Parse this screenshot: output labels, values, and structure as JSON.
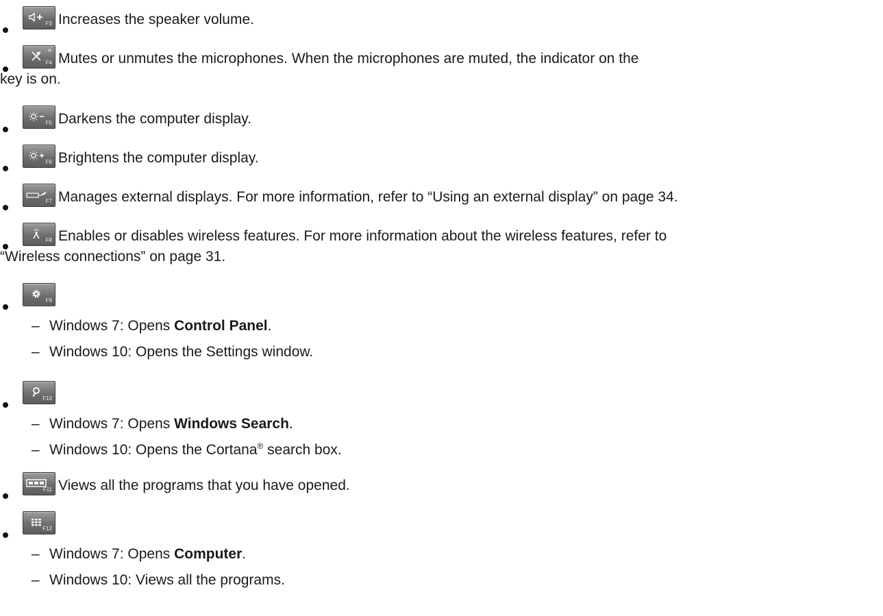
{
  "items": [
    {
      "key_label": "F3",
      "icon": "volume-up-icon",
      "text": "Increases the speaker volume."
    },
    {
      "key_label": "F4",
      "icon": "microphone-mute-icon",
      "text_line1": "Mutes or unmutes the microphones. When the microphones are muted, the indicator on the",
      "text_line2": "key is on."
    },
    {
      "key_label": "F5",
      "icon": "brightness-down-icon",
      "text": "Darkens the computer display."
    },
    {
      "key_label": "F6",
      "icon": "brightness-up-icon",
      "text": "Brightens the computer display."
    },
    {
      "key_label": "F7",
      "icon": "external-display-icon",
      "text": "Manages external displays. For more information, refer to “Using an external display” on page 34."
    },
    {
      "key_label": "F8",
      "icon": "wireless-icon",
      "text_line1": "Enables or disables wireless features. For more information about the wireless features, refer to",
      "text_line2": "“Wireless connections” on page 31."
    },
    {
      "key_label": "F9",
      "icon": "settings-gear-icon",
      "subs": [
        {
          "prefix": "Windows 7: Opens ",
          "bold": "Control Panel",
          "suffix": "."
        },
        {
          "text": "Windows 10: Opens the Settings window."
        }
      ]
    },
    {
      "key_label": "F10",
      "icon": "search-icon",
      "subs": [
        {
          "prefix": "Windows 7: Opens ",
          "bold": "Windows Search",
          "suffix": "."
        },
        {
          "prefix": "Windows 10: Opens the Cortana",
          "sup": "®",
          "suffix": " search box."
        }
      ]
    },
    {
      "key_label": "F11",
      "icon": "task-view-icon",
      "text": "Views all the programs that you have opened."
    },
    {
      "key_label": "F12",
      "icon": "all-programs-grid-icon",
      "subs": [
        {
          "prefix": "Windows 7: Opens ",
          "bold": "Computer",
          "suffix": "."
        },
        {
          "text": "Windows 10: Views all the programs."
        }
      ]
    }
  ]
}
